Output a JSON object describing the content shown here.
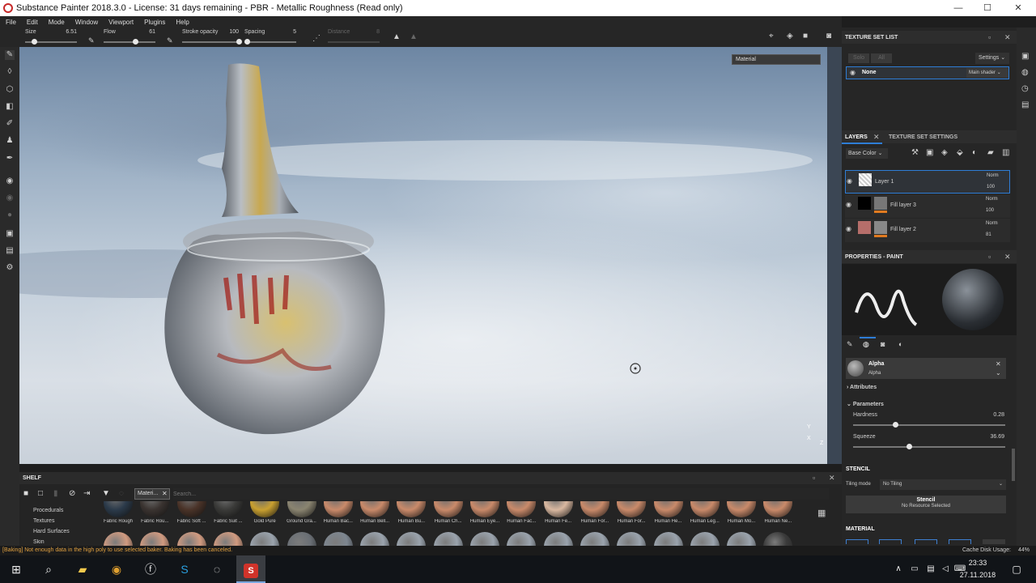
{
  "title_bar": {
    "title": "Substance Painter 2018.3.0 - License: 31 days remaining - PBR - Metallic Roughness (Read only)",
    "minimize": "—",
    "maximize": "☐",
    "close": "✕"
  },
  "menu": [
    "File",
    "Edit",
    "Mode",
    "Window",
    "Viewport",
    "Plugins",
    "Help"
  ],
  "tool_options": {
    "size_label": "Size",
    "size_value": "6.51",
    "size_level": 0.18,
    "flow_label": "Flow",
    "flow_value": "61",
    "flow_level": 0.61,
    "stroke_opacity_label": "Stroke opacity",
    "stroke_opacity_value": "100",
    "stroke_opacity_level": 1.0,
    "spacing_label": "Spacing",
    "spacing_value": "5",
    "spacing_level": 0.05,
    "distance_label": "Distance",
    "distance_value": "8"
  },
  "viewport": {
    "material_select": "Material",
    "axis_y": "Y",
    "axis_x": "X",
    "axis_z": "Z"
  },
  "texture_set_list": {
    "title": "TEXTURE SET LIST",
    "solo": "Solo",
    "all": "All",
    "settings": "Settings",
    "item_name": "None",
    "item_shader": "Main shader"
  },
  "layers": {
    "tab_layers": "LAYERS",
    "tab_settings": "TEXTURE SET SETTINGS",
    "channel": "Base Color",
    "rows": [
      {
        "name": "Layer 1",
        "blend": "Norm",
        "opacity": "100"
      },
      {
        "name": "Fill layer 3",
        "blend": "Norm",
        "opacity": "100"
      },
      {
        "name": "Fill layer 2",
        "blend": "Norm",
        "opacity": "81"
      }
    ]
  },
  "properties": {
    "title": "PROPERTIES - PAINT",
    "alpha_title": "Alpha",
    "alpha_sub": "Alpha",
    "attributes": "Attributes",
    "parameters": "Parameters",
    "hardness_label": "Hardness",
    "hardness_value": "0.28",
    "hardness_level": 0.28,
    "squeeze_label": "Squeeze",
    "squeeze_value": "36.69",
    "squeeze_level": 0.37,
    "stencil_header": "STENCIL",
    "tiling_label": "Tiling mode",
    "tiling_value": "No Tiling",
    "stencil_box_title": "Stencil",
    "stencil_box_sub": "No Resource Selected",
    "material_header": "MATERIAL"
  },
  "shelf": {
    "title": "SHELF",
    "filter_tag": "Materi...",
    "search_placeholder": "Search...",
    "categories": [
      "Procedurals",
      "Textures",
      "Hard Surfaces",
      "Skin"
    ],
    "items_row1": [
      {
        "label": "Fabric Rough",
        "color": "#2b3a4a"
      },
      {
        "label": "Fabric Rou...",
        "color": "#3a3330"
      },
      {
        "label": "Fabric Soft ...",
        "color": "#4a3328"
      },
      {
        "label": "Fabric Suit ...",
        "color": "#3a3a38"
      },
      {
        "label": "Gold Pure",
        "color": "#c9a030"
      },
      {
        "label": "Ground Gra...",
        "color": "#8a8470"
      },
      {
        "label": "Human Bac...",
        "color": "#c98a6a"
      },
      {
        "label": "Human Bell...",
        "color": "#c98a6a"
      },
      {
        "label": "Human Bu...",
        "color": "#c98a6a"
      },
      {
        "label": "Human Ch...",
        "color": "#c98a6a"
      },
      {
        "label": "Human Eye...",
        "color": "#c98a6a"
      },
      {
        "label": "Human Fac...",
        "color": "#c98a6a"
      },
      {
        "label": "Human Fe...",
        "color": "#d9b8a0"
      },
      {
        "label": "Human For...",
        "color": "#c98a6a"
      },
      {
        "label": "Human For...",
        "color": "#c98a6a"
      },
      {
        "label": "Human He...",
        "color": "#c98a6a"
      },
      {
        "label": "Human Leg...",
        "color": "#c98a6a"
      },
      {
        "label": "Human Mo...",
        "color": "#c98a6a"
      },
      {
        "label": "Human Ne...",
        "color": "#c98a6a"
      }
    ],
    "items_row2_colors": [
      "#d09a80",
      "#d09a80",
      "#d09a80",
      "#d09a80",
      "#9aa3ad",
      "#6a6f75",
      "#7d8690",
      "#9aa3ad",
      "#9aa3ad",
      "#9aa3ad",
      "#9aa3ad",
      "#9aa3ad",
      "#9aa3ad",
      "#9aa3ad",
      "#9aa3ad",
      "#9aa3ad",
      "#9aa3ad",
      "#9aa3ad",
      "#3a3a3a"
    ]
  },
  "status": {
    "message": "[Baking] Not enough data in the high poly to use selected baker. Baking has been canceled.",
    "cache_label": "Cache Disk Usage:",
    "cache_value": "44%"
  },
  "taskbar": {
    "time": "23:33",
    "date": "27.11.2018"
  },
  "colors": {
    "accent": "#2e7dd6",
    "warning_text": "#e0a040",
    "panel_bg": "#262626"
  }
}
